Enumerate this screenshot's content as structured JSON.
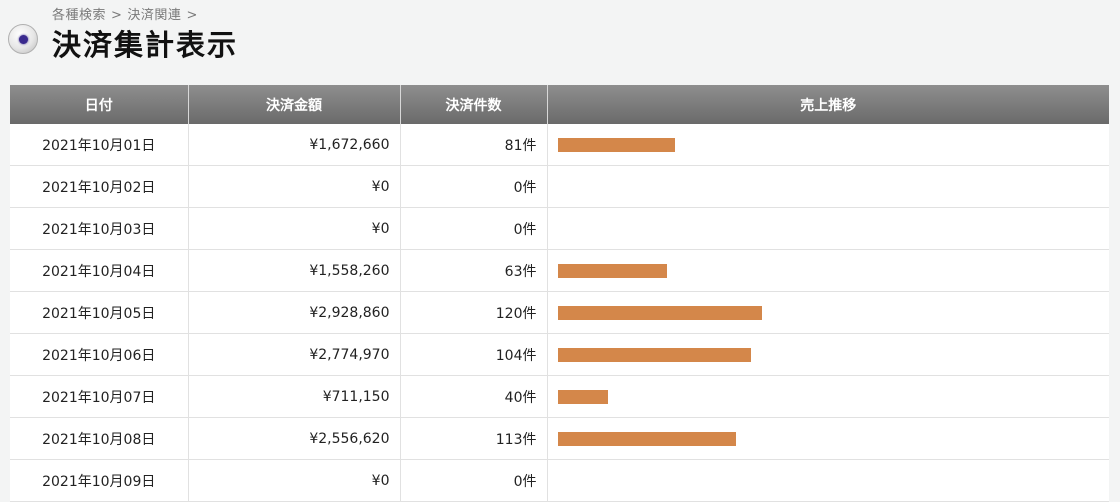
{
  "breadcrumb": {
    "item1": "各種検索",
    "item2": "決済関連",
    "separator": ">"
  },
  "page_title": "決済集計表示",
  "colors": {
    "bar": "#d4874a",
    "header_bg": "#7c7c7c"
  },
  "table": {
    "headers": {
      "date": "日付",
      "amount": "決済金額",
      "count": "決済件数",
      "trend": "売上推移"
    },
    "rows": [
      {
        "date": "2021年10月01日",
        "amount": "¥1,672,660",
        "count": "81件",
        "sales": 1672660
      },
      {
        "date": "2021年10月02日",
        "amount": "¥0",
        "count": "0件",
        "sales": 0
      },
      {
        "date": "2021年10月03日",
        "amount": "¥0",
        "count": "0件",
        "sales": 0
      },
      {
        "date": "2021年10月04日",
        "amount": "¥1,558,260",
        "count": "63件",
        "sales": 1558260
      },
      {
        "date": "2021年10月05日",
        "amount": "¥2,928,860",
        "count": "120件",
        "sales": 2928860
      },
      {
        "date": "2021年10月06日",
        "amount": "¥2,774,970",
        "count": "104件",
        "sales": 2774970
      },
      {
        "date": "2021年10月07日",
        "amount": "¥711,150",
        "count": "40件",
        "sales": 711150
      },
      {
        "date": "2021年10月08日",
        "amount": "¥2,556,620",
        "count": "113件",
        "sales": 2556620
      },
      {
        "date": "2021年10月09日",
        "amount": "¥0",
        "count": "0件",
        "sales": 0
      }
    ]
  }
}
